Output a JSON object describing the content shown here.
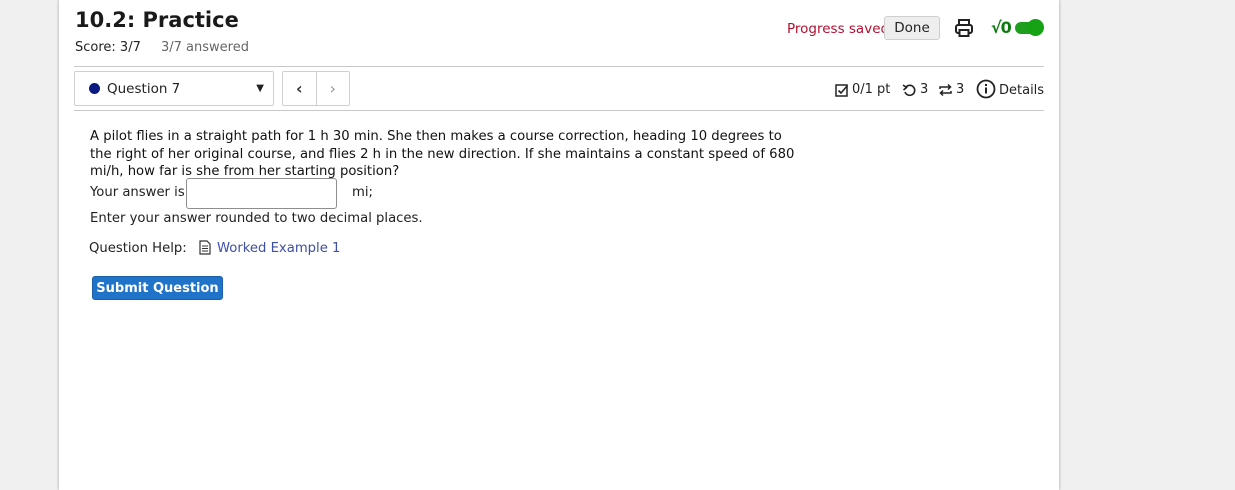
{
  "header": {
    "title": "10.2: Practice",
    "score": "Score: 3/7",
    "answered": "3/7 answered",
    "progress_status": "Progress saved",
    "done_label": "Done",
    "sqrt_symbol": "√0"
  },
  "question_nav": {
    "selected": "Question 7",
    "prev_symbol": "‹",
    "next_symbol": "›",
    "points": "0/1 pt",
    "retries": "3",
    "versions": "3",
    "details": "Details"
  },
  "question": {
    "text": "A pilot flies in a straight path for 1 h 30 min. She then makes a course correction, heading 10 degrees to the right of her original course, and flies 2 h in the new direction. If she maintains a constant speed of 680 mi/h, how far is she from her starting position?",
    "answer_prefix": "Your answer is",
    "answer_value": "",
    "unit": "mi;",
    "instruction": "Enter your answer rounded to two decimal places.",
    "help_label": "Question Help:",
    "help_link": "Worked Example 1",
    "submit_label": "Submit Question"
  },
  "colors": {
    "progress_text": "#b2102f",
    "toggle": "#1d9e1d",
    "submit_bg": "#1f73c8",
    "link": "#3d4fa7",
    "question_dot": "#0a1a80"
  }
}
